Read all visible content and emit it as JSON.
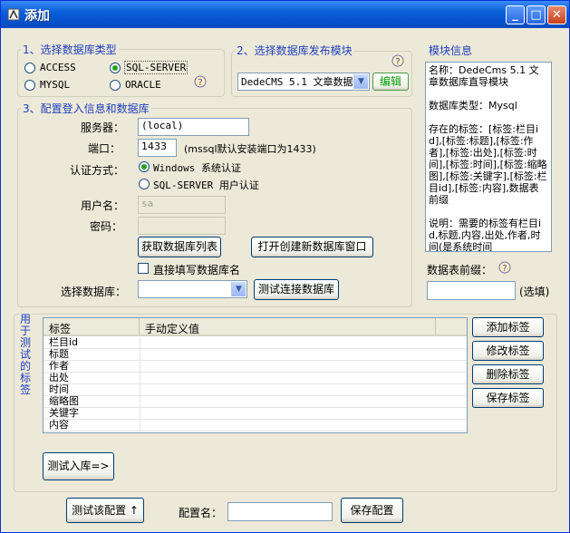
{
  "window": {
    "title": "添加"
  },
  "db_type": {
    "legend": "1、选择数据库类型",
    "options": [
      "ACCESS",
      "SQL-SERVER",
      "MYSQL",
      "ORACLE"
    ],
    "selected": "SQL-SERVER"
  },
  "module": {
    "legend": "2、选择数据库发布模块",
    "selected": "DedeCMS 5.1 文章数据,",
    "edit_label": "编辑"
  },
  "module_info": {
    "legend": "模块信息",
    "lines": [
      "名称：DedeCms 5.1 文章数据库直导模块",
      "数据库类型：Mysql",
      "存在的标签：[标签:栏目id],[标签:标题],[标签:作者],[标签:出处],[标签:时间],[标签:时间],[标签:缩略图],[标签:关键字],[标签:栏目id],[标签:内容],数据表前缀",
      "说明：需要的标签有栏目id,标题,内容,出处,作者,时间(是系统时间"
    ],
    "prefix_label": "数据表前缀：",
    "prefix_value": "",
    "optional_label": "(选填)"
  },
  "config": {
    "legend": "3、配置登入信息和数据库",
    "server_label": "服务器：",
    "server_value": "(local)",
    "port_label": "端口：",
    "port_value": "1433",
    "port_hint": "(mssql默认安装端口为1433)",
    "auth_label": "认证方式：",
    "auth_windows": "Windows 系统认证",
    "auth_sql": "SQL-SERVER 用户认证",
    "user_label": "用户名：",
    "user_value": "sa",
    "password_label": "密码：",
    "password_value": "",
    "get_db_list": "获取数据库列表",
    "open_create_db": "打开创建新数据库窗口",
    "direct_fill": "直接填写数据库名",
    "select_db_label": "选择数据库：",
    "select_db_value": "",
    "test_conn": "测试连接数据库"
  },
  "tags": {
    "legend": "用于测试的标签",
    "col_tag": "标签",
    "col_value": "手动定义值",
    "rows": [
      "栏目id",
      "标题",
      "作者",
      "出处",
      "时间",
      "缩略图",
      "关键字",
      "内容"
    ],
    "add": "添加标签",
    "modify": "修改标签",
    "delete": "删除标签",
    "save": "保存标签",
    "test_import": "测试入库=>"
  },
  "footer": {
    "test_config": "测试该配置 ↑",
    "config_name_label": "配置名：",
    "config_name_value": "",
    "save_config": "保存配置"
  }
}
